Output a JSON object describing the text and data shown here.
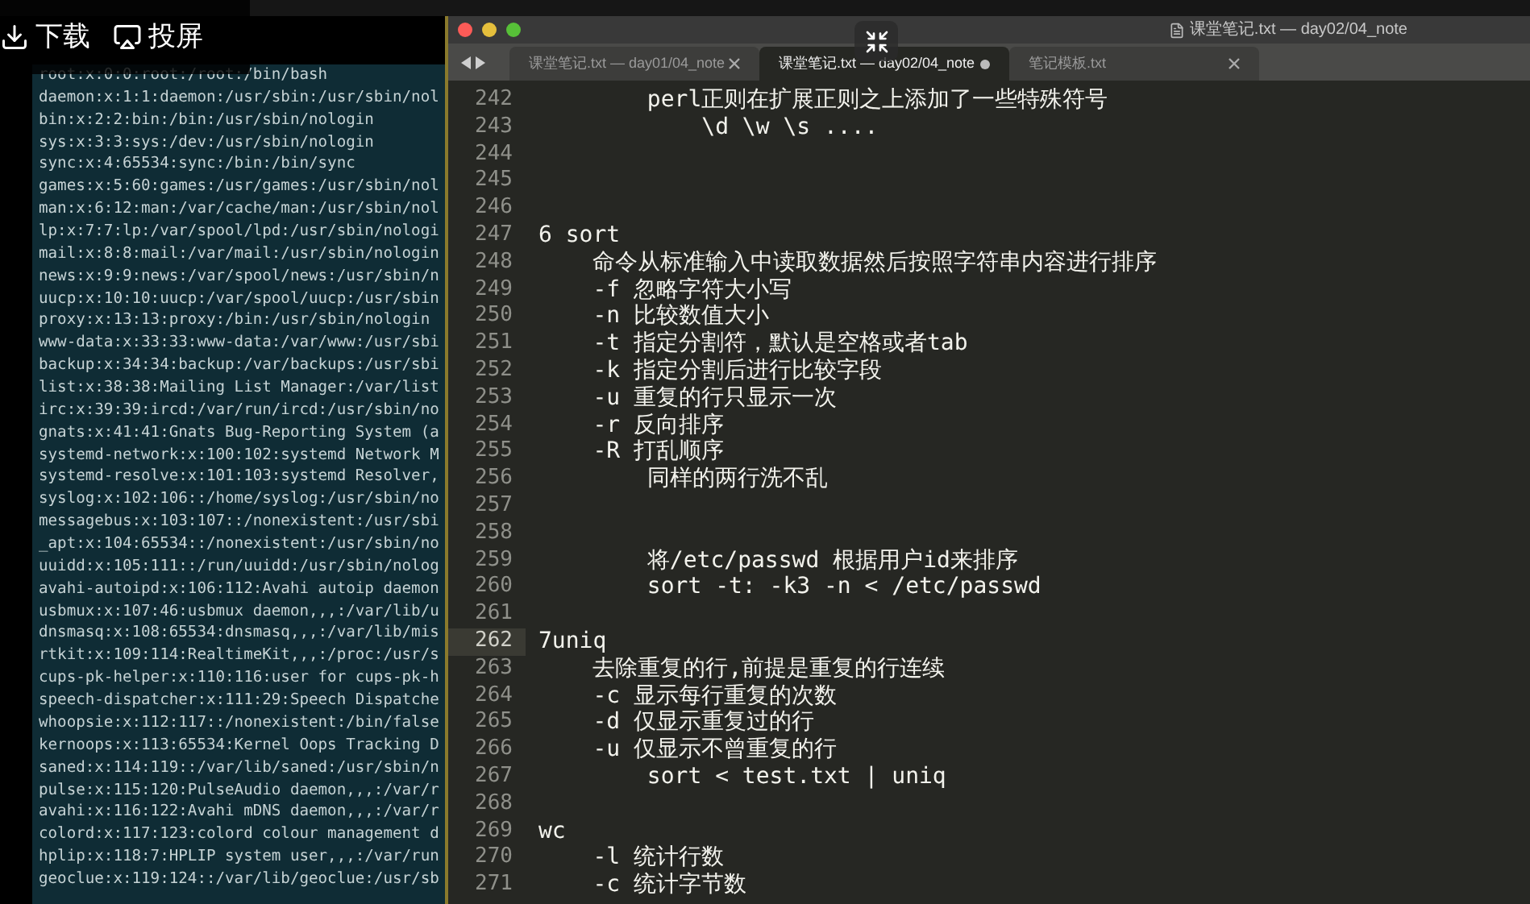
{
  "player_overlay": {
    "buttons": [
      {
        "kind": "download",
        "label": "下载"
      },
      {
        "kind": "cast",
        "label": "投屏"
      }
    ]
  },
  "terminal": {
    "lines": [
      "root:x:0:0:root:/root:/bin/bash",
      "daemon:x:1:1:daemon:/usr/sbin:/usr/sbin/nol",
      "bin:x:2:2:bin:/bin:/usr/sbin/nologin",
      "sys:x:3:3:sys:/dev:/usr/sbin/nologin",
      "sync:x:4:65534:sync:/bin:/bin/sync",
      "games:x:5:60:games:/usr/games:/usr/sbin/nol",
      "man:x:6:12:man:/var/cache/man:/usr/sbin/nol",
      "lp:x:7:7:lp:/var/spool/lpd:/usr/sbin/nologi",
      "mail:x:8:8:mail:/var/mail:/usr/sbin/nologin",
      "news:x:9:9:news:/var/spool/news:/usr/sbin/n",
      "uucp:x:10:10:uucp:/var/spool/uucp:/usr/sbin",
      "proxy:x:13:13:proxy:/bin:/usr/sbin/nologin",
      "www-data:x:33:33:www-data:/var/www:/usr/sbi",
      "backup:x:34:34:backup:/var/backups:/usr/sbi",
      "list:x:38:38:Mailing List Manager:/var/list",
      "irc:x:39:39:ircd:/var/run/ircd:/usr/sbin/no",
      "gnats:x:41:41:Gnats Bug-Reporting System (a",
      "systemd-network:x:100:102:systemd Network M",
      "systemd-resolve:x:101:103:systemd Resolver,",
      "syslog:x:102:106::/home/syslog:/usr/sbin/no",
      "messagebus:x:103:107::/nonexistent:/usr/sbi",
      "_apt:x:104:65534::/nonexistent:/usr/sbin/no",
      "uuidd:x:105:111::/run/uuidd:/usr/sbin/nolog",
      "avahi-autoipd:x:106:112:Avahi autoip daemon",
      "usbmux:x:107:46:usbmux daemon,,,:/var/lib/u",
      "dnsmasq:x:108:65534:dnsmasq,,,:/var/lib/mis",
      "rtkit:x:109:114:RealtimeKit,,,:/proc:/usr/s",
      "cups-pk-helper:x:110:116:user for cups-pk-h",
      "speech-dispatcher:x:111:29:Speech Dispatche",
      "whoopsie:x:112:117::/nonexistent:/bin/false",
      "kernoops:x:113:65534:Kernel Oops Tracking D",
      "saned:x:114:119::/var/lib/saned:/usr/sbin/n",
      "pulse:x:115:120:PulseAudio daemon,,,:/var/r",
      "avahi:x:116:122:Avahi mDNS daemon,,,:/var/r",
      "colord:x:117:123:colord colour management d",
      "hplip:x:118:7:HPLIP system user,,,:/var/run",
      "geoclue:x:119:124::/var/lib/geoclue:/usr/sb"
    ]
  },
  "editor": {
    "window_title": "课堂笔记.txt — day02/04_note",
    "tabs": [
      {
        "label": "课堂笔记.txt — day01/04_note",
        "selected": false,
        "modified": false
      },
      {
        "label": "课堂笔记.txt — day02/04_note",
        "selected": true,
        "modified": true
      },
      {
        "label": "笔记模板.txt",
        "selected": false,
        "modified": false
      }
    ],
    "lines": [
      {
        "number": "242",
        "text": "        perl正则在扩展正则之上添加了一些特殊符号",
        "current": false
      },
      {
        "number": "243",
        "text": "            \\d \\w \\s ....",
        "current": false
      },
      {
        "number": "244",
        "current": false
      },
      {
        "number": "245",
        "current": false
      },
      {
        "number": "246",
        "current": false
      },
      {
        "number": "247",
        "text": "6 sort",
        "current": false
      },
      {
        "number": "248",
        "text": "    命令从标准输入中读取数据然后按照字符串内容进行排序",
        "current": false
      },
      {
        "number": "249",
        "text": "    -f 忽略字符大小写",
        "current": false
      },
      {
        "number": "250",
        "text": "    -n 比较数值大小",
        "current": false
      },
      {
        "number": "251",
        "text": "    -t 指定分割符，默认是空格或者tab",
        "current": false
      },
      {
        "number": "252",
        "text": "    -k 指定分割后进行比较字段",
        "current": false
      },
      {
        "number": "253",
        "text": "    -u 重复的行只显示一次",
        "current": false
      },
      {
        "number": "254",
        "text": "    -r 反向排序",
        "current": false
      },
      {
        "number": "255",
        "text": "    -R 打乱顺序",
        "current": false
      },
      {
        "number": "256",
        "text": "        同样的两行洗不乱",
        "current": false
      },
      {
        "number": "257",
        "current": false
      },
      {
        "number": "258",
        "current": false
      },
      {
        "number": "259",
        "text": "        将/etc/passwd 根据用户id来排序",
        "current": false
      },
      {
        "number": "260",
        "text": "        sort -t: -k3 -n < /etc/passwd",
        "current": false
      },
      {
        "number": "261",
        "current": false
      },
      {
        "number": "262",
        "text": "7uniq",
        "current": true
      },
      {
        "number": "263",
        "text": "    去除重复的行,前提是重复的行连续",
        "current": false
      },
      {
        "number": "264",
        "text": "    -c 显示每行重复的次数",
        "current": false
      },
      {
        "number": "265",
        "text": "    -d 仅显示重复过的行",
        "current": false
      },
      {
        "number": "266",
        "text": "    -u 仅显示不曾重复的行",
        "current": false
      },
      {
        "number": "267",
        "text": "        sort < test.txt | uniq",
        "current": false
      },
      {
        "number": "268",
        "current": false
      },
      {
        "number": "269",
        "text": "wc",
        "current": false
      },
      {
        "number": "270",
        "text": "    -l 统计行数",
        "current": false
      },
      {
        "number": "271",
        "text": "    -c 统计字节数",
        "current": false
      }
    ]
  }
}
